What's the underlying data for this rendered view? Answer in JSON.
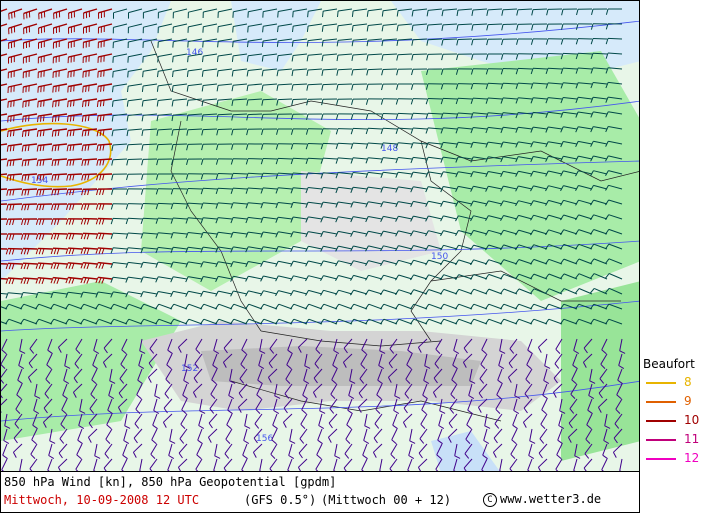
{
  "map": {
    "level": "850 hPa",
    "contour_labels": [
      "146",
      "148",
      "150",
      "152",
      "154",
      "156"
    ]
  },
  "footer": {
    "line1": "850 hPa Wind [kn], 850 hPa Geopotential [gpdm]",
    "date_time": "Mittwoch, 10-09-2008  12 UTC",
    "model": "(GFS 0.5°)",
    "run": "(Mittwoch 00 + 12)",
    "copyright_symbol": "C",
    "copyright": "www.wetter3.de"
  },
  "legend": {
    "title": "Beaufort",
    "items": [
      {
        "value": "8",
        "color": "#e8b400"
      },
      {
        "value": "9",
        "color": "#e06000"
      },
      {
        "value": "10",
        "color": "#a00000"
      },
      {
        "value": "11",
        "color": "#c0007a"
      },
      {
        "value": "12",
        "color": "#f000c0"
      }
    ]
  },
  "colors": {
    "sea": "#d6eafa",
    "land_low": "#d8f5d0",
    "green": "#90e890",
    "alps": "#d0d0d0",
    "wind_barb": "#004848",
    "barb_purple": "#40008c",
    "contour": "#4455ee"
  }
}
